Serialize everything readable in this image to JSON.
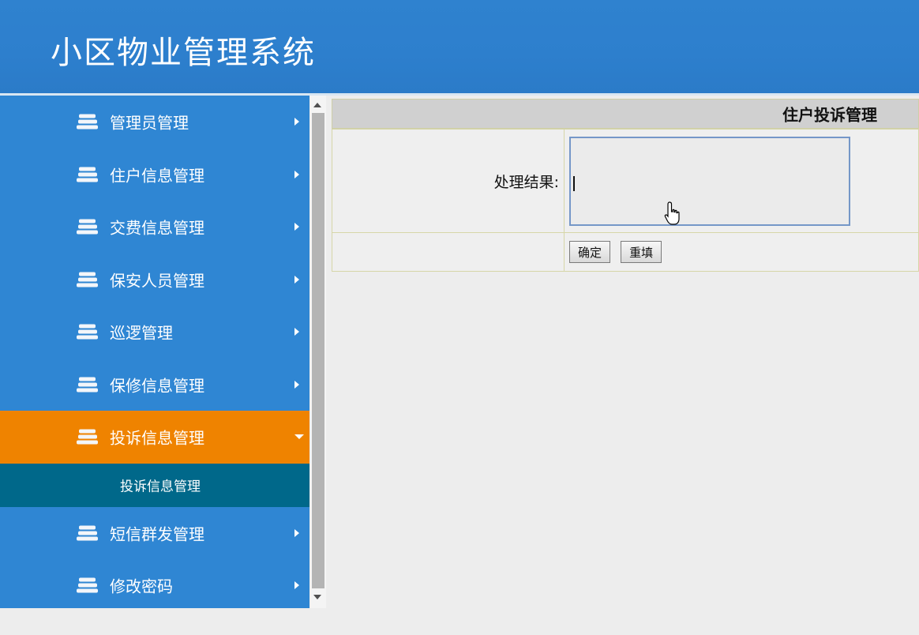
{
  "app": {
    "title": "小区物业管理系统"
  },
  "sidebar": {
    "items": [
      {
        "label": "管理员管理",
        "icon": "stack-icon"
      },
      {
        "label": "住户信息管理",
        "icon": "stack-icon"
      },
      {
        "label": "交费信息管理",
        "icon": "stack-icon"
      },
      {
        "label": "保安人员管理",
        "icon": "stack-icon"
      },
      {
        "label": "巡逻管理",
        "icon": "stack-icon"
      },
      {
        "label": "保修信息管理",
        "icon": "stack-icon"
      },
      {
        "label": "投诉信息管理",
        "icon": "stack-icon",
        "active": true
      },
      {
        "label": "短信群发管理",
        "icon": "stack-icon"
      },
      {
        "label": "修改密码",
        "icon": "stack-icon"
      }
    ],
    "submenu": [
      {
        "label": "投诉信息管理"
      }
    ]
  },
  "content": {
    "title": "住户投诉管理",
    "form": {
      "result_label": "处理结果:",
      "result_value": ""
    },
    "buttons": {
      "confirm": "确定",
      "reset": "重填"
    }
  },
  "colors": {
    "header": "#2d7fcd",
    "sidebar": "#2f86d3",
    "active_item": "#ef8300",
    "submenu": "#00688a"
  }
}
